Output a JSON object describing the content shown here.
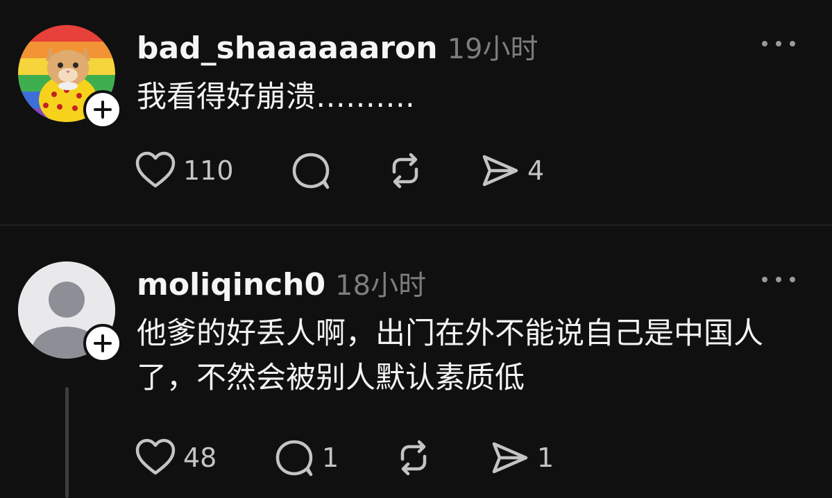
{
  "posts": [
    {
      "username": "bad_shaaaaaaron",
      "time": "19小时",
      "text": "我看得好崩溃……….",
      "likes": "110",
      "replies": "",
      "reposts": "",
      "shares": "4",
      "avatar": "cat-photo-avatar"
    },
    {
      "username": "moliqinch0",
      "time": "18小时",
      "text": "他爹的好丢人啊，出门在外不能说自己是中国人了，不然会被别人默认素质低",
      "likes": "48",
      "replies": "1",
      "reposts": "",
      "shares": "1",
      "avatar": "default-user-avatar"
    }
  ],
  "icons": {
    "like": "heart-icon",
    "reply": "comment-bubble-icon",
    "repost": "repost-arrows-icon",
    "share": "send-paper-plane-icon",
    "more": "more-dots-icon",
    "follow": "plus-icon"
  },
  "colors": {
    "background": "#101010",
    "text": "#f3f3f3",
    "muted": "#7d7d7d",
    "icon": "#c4c4c4"
  }
}
